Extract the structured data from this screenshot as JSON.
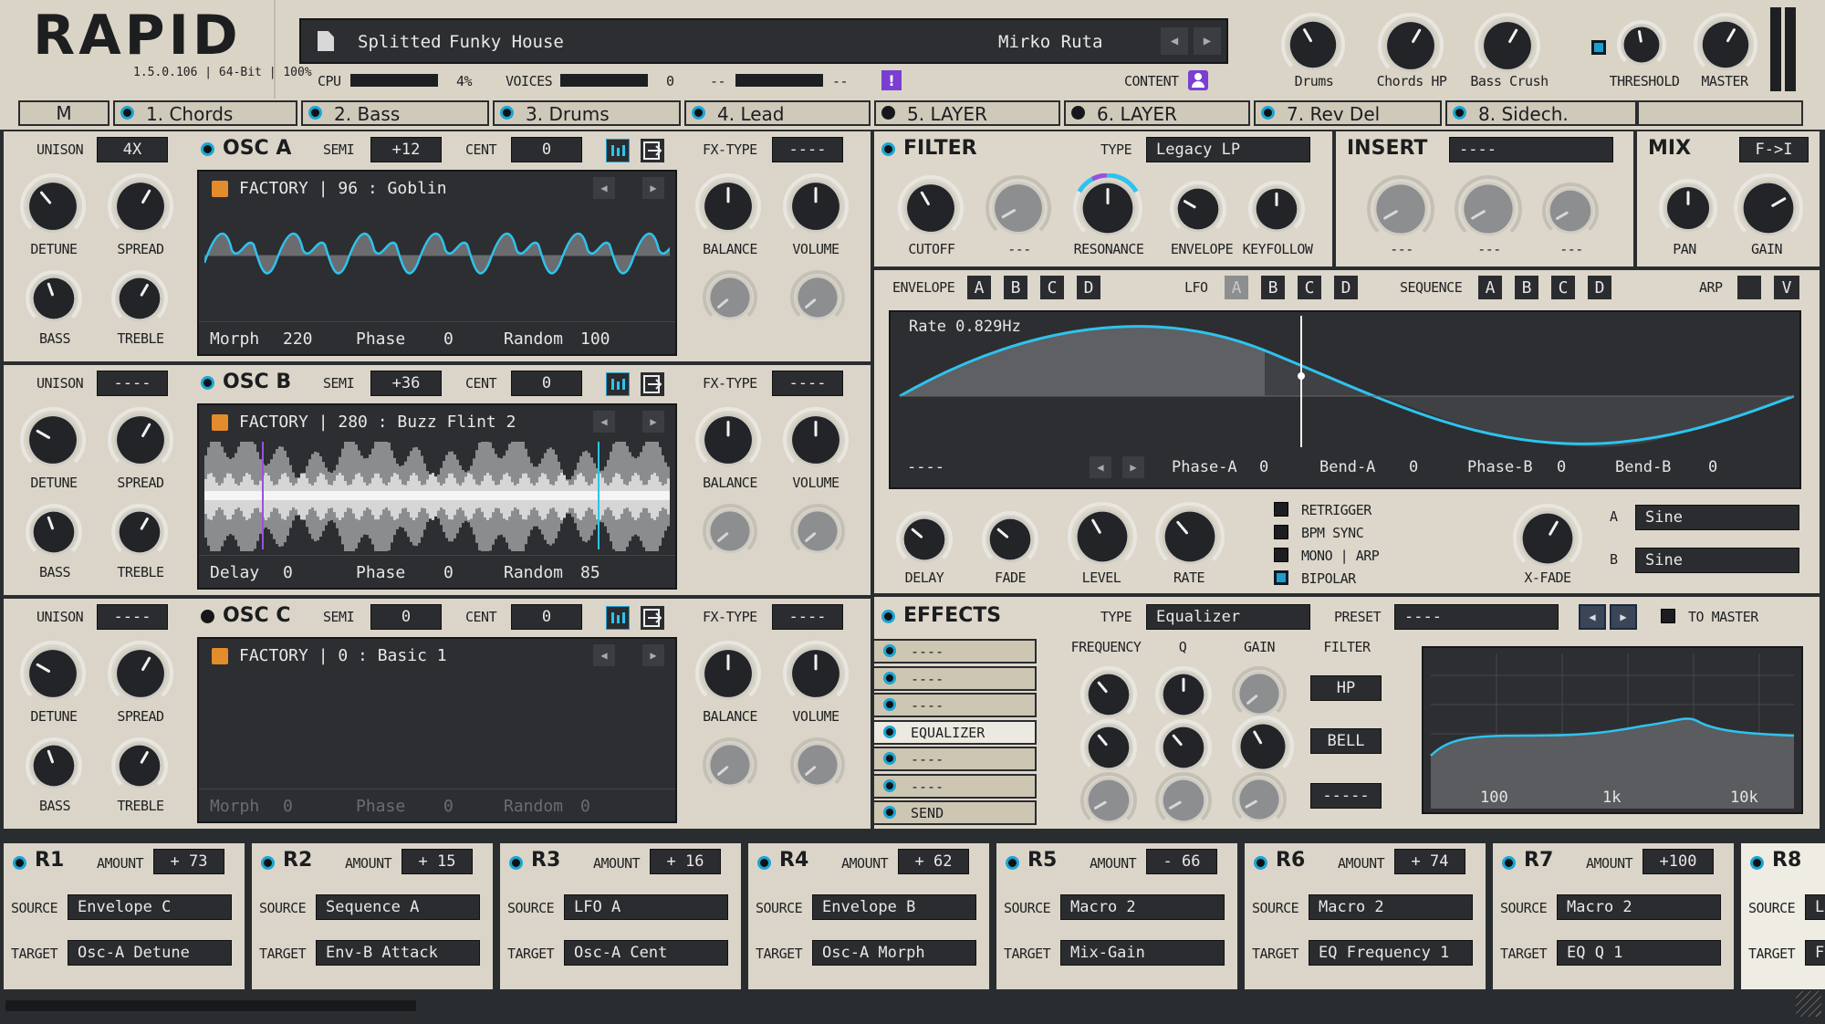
{
  "header": {
    "logo": "RAPID",
    "version": "1.5.0.106 | 64-Bit | 100%",
    "preset_bank": "Splitted",
    "preset_name": "Funky House",
    "author": "Mirko Ruta",
    "cpu_label": "CPU",
    "cpu_value": "4%",
    "voices_label": "VOICES",
    "voices_value": "0",
    "dash1": "--",
    "dash2": "--",
    "content_label": "CONTENT"
  },
  "macros": [
    {
      "label": "Drums"
    },
    {
      "label": "Chords HP"
    },
    {
      "label": "Bass Crush"
    },
    {
      "label": "THRESHOLD"
    },
    {
      "label": "MASTER"
    }
  ],
  "layers": {
    "m_label": "M",
    "tabs": [
      {
        "label": "1. Chords",
        "on": true
      },
      {
        "label": "2. Bass",
        "on": true
      },
      {
        "label": "3. Drums",
        "on": true
      },
      {
        "label": "4. Lead",
        "on": true
      },
      {
        "label": "5. LAYER",
        "on": false
      },
      {
        "label": "6. LAYER",
        "on": false
      },
      {
        "label": "7. Rev Del",
        "on": true
      },
      {
        "label": "8. Sidech.",
        "on": true
      }
    ]
  },
  "osc": [
    {
      "name": "OSC A",
      "unison": "4X",
      "semi": "+12",
      "cent": "0",
      "fx": "----",
      "wave": "FACTORY | 96 : Goblin",
      "p1": "Morph",
      "v1": "220",
      "p2": "Phase",
      "v2": "0",
      "p3": "Random",
      "v3": "100"
    },
    {
      "name": "OSC B",
      "unison": "----",
      "semi": "+36",
      "cent": "0",
      "fx": "----",
      "wave": "FACTORY | 280 : Buzz Flint 2",
      "p1": "Delay",
      "v1": "0",
      "p2": "Phase",
      "v2": "0",
      "p3": "Random",
      "v3": "85"
    },
    {
      "name": "OSC C",
      "unison": "----",
      "semi": "0",
      "cent": "0",
      "fx": "----",
      "wave": "FACTORY | 0 : Basic 1",
      "p1": "Morph",
      "v1": "0",
      "p2": "Phase",
      "v2": "0",
      "p3": "Random",
      "v3": "0"
    }
  ],
  "osc_labels": {
    "unison": "UNISON",
    "semi": "SEMI",
    "cent": "CENT",
    "fx": "FX-TYPE",
    "detune": "DETUNE",
    "spread": "SPREAD",
    "bass": "BASS",
    "treble": "TREBLE",
    "balance": "BALANCE",
    "volume": "VOLUME"
  },
  "filter": {
    "title": "FILTER",
    "type_label": "TYPE",
    "type": "Legacy LP",
    "k1": "CUTOFF",
    "k2": "---",
    "k3": "RESONANCE",
    "k4": "ENVELOPE",
    "k5": "KEYFOLLOW"
  },
  "insert": {
    "title": "INSERT",
    "type": "----",
    "k1": "---",
    "k2": "---",
    "k3": "---"
  },
  "mix": {
    "title": "MIX",
    "mode": "F->I",
    "k1": "PAN",
    "k2": "GAIN"
  },
  "mod": {
    "envelope": "ENVELOPE",
    "lfo": "LFO",
    "sequence": "SEQUENCE",
    "arp": "ARP",
    "arp_v": "V",
    "letters": [
      "A",
      "B",
      "C",
      "D"
    ],
    "rate": "Rate 0.829Hz",
    "dash": "----",
    "phase_a": "Phase-A",
    "phase_a_v": "0",
    "bend_a": "Bend-A",
    "bend_a_v": "0",
    "phase_b": "Phase-B",
    "phase_b_v": "0",
    "bend_b": "Bend-B",
    "bend_b_v": "0",
    "k_delay": "DELAY",
    "k_fade": "FADE",
    "k_level": "LEVEL",
    "k_rate": "RATE",
    "retrigger": "RETRIGGER",
    "bpm": "BPM SYNC",
    "mono": "MONO | ARP",
    "bipolar": "BIPOLAR",
    "xfade": "X-FADE",
    "a_label": "A",
    "a_val": "Sine",
    "b_label": "B",
    "b_val": "Sine"
  },
  "effects": {
    "title": "EFFECTS",
    "type_label": "TYPE",
    "type": "Equalizer",
    "preset_label": "PRESET",
    "preset": "----",
    "to_master": "TO MASTER",
    "slots": [
      "----",
      "----",
      "----",
      "EQUALIZER",
      "----",
      "----",
      "SEND"
    ],
    "freq": "FREQUENCY",
    "q": "Q",
    "gain": "GAIN",
    "filter": "FILTER",
    "f1": "HP",
    "f2": "BELL",
    "f3": "-----",
    "ax1": "100",
    "ax2": "1k",
    "ax3": "10k"
  },
  "routing": [
    {
      "id": "R1",
      "amount": "+ 73",
      "source": "Envelope C",
      "target": "Osc-A Detune"
    },
    {
      "id": "R2",
      "amount": "+ 15",
      "source": "Sequence A",
      "target": "Env-B Attack"
    },
    {
      "id": "R3",
      "amount": "+ 16",
      "source": "LFO A",
      "target": "Osc-A Cent"
    },
    {
      "id": "R4",
      "amount": "+ 62",
      "source": "Envelope B",
      "target": "Osc-A Morph"
    },
    {
      "id": "R5",
      "amount": "- 66",
      "source": "Macro 2",
      "target": "Mix-Gain"
    },
    {
      "id": "R6",
      "amount": "+ 74",
      "source": "Macro 2",
      "target": "EQ Frequency 1"
    },
    {
      "id": "R7",
      "amount": "+100",
      "source": "Macro 2",
      "target": "EQ Q 1"
    },
    {
      "id": "R8",
      "amount": "",
      "source": "L",
      "target": "F"
    }
  ],
  "routing_labels": {
    "amount": "AMOUNT",
    "source": "SOURCE",
    "target": "TARGET"
  }
}
